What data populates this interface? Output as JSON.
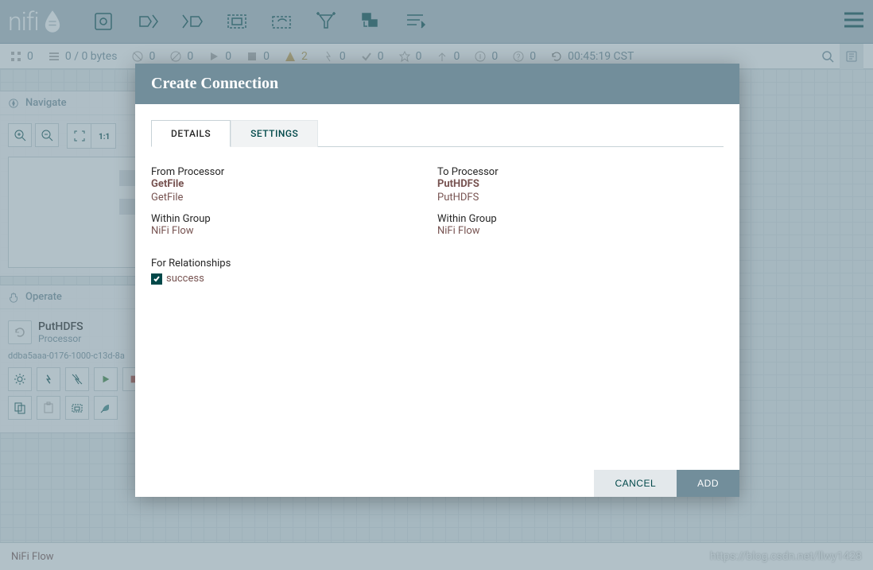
{
  "logo_text": "nifi",
  "status": {
    "items": [
      {
        "icon": "grid",
        "value": "0",
        "color": "#707070"
      },
      {
        "icon": "queue",
        "value": "0 / 0 bytes",
        "color": "#707070"
      },
      {
        "icon": "disabled",
        "value": "0",
        "color": "#707070"
      },
      {
        "icon": "invalid",
        "value": "0",
        "color": "#707070"
      },
      {
        "icon": "play",
        "value": "0",
        "color": "#707070"
      },
      {
        "icon": "stop",
        "value": "0",
        "color": "#707070"
      },
      {
        "icon": "warn",
        "value": "2",
        "color": "#ba554a"
      },
      {
        "icon": "thread",
        "value": "0",
        "color": "#707070"
      },
      {
        "icon": "check",
        "value": "0",
        "color": "#707070"
      },
      {
        "icon": "snow",
        "value": "0",
        "color": "#707070"
      },
      {
        "icon": "up",
        "value": "0",
        "color": "#707070"
      },
      {
        "icon": "info",
        "value": "0",
        "color": "#707070"
      },
      {
        "icon": "help",
        "value": "0",
        "color": "#707070"
      }
    ],
    "refresh_time": "00:45:19 CST"
  },
  "left": {
    "navigate": "Navigate",
    "operate": "Operate",
    "proc_name": "PutHDFS",
    "proc_type": "Processor",
    "uuid": "ddba5aaa-0176-1000-c13d-8a"
  },
  "dialog": {
    "title": "Create Connection",
    "tab_details": "DETAILS",
    "tab_settings": "SETTINGS",
    "from_label": "From Processor",
    "from_name": "GetFile",
    "from_type": "GetFile",
    "from_group_label": "Within Group",
    "from_group": "NiFi Flow",
    "to_label": "To Processor",
    "to_name": "PutHDFS",
    "to_type": "PutHDFS",
    "to_group_label": "Within Group",
    "to_group": "NiFi Flow",
    "rel_label": "For Relationships",
    "rel_name": "success",
    "cancel": "CANCEL",
    "add": "ADD"
  },
  "footer": {
    "breadcrumb": "NiFi Flow",
    "watermark": "https://blog.csdn.net/llwy1428"
  }
}
